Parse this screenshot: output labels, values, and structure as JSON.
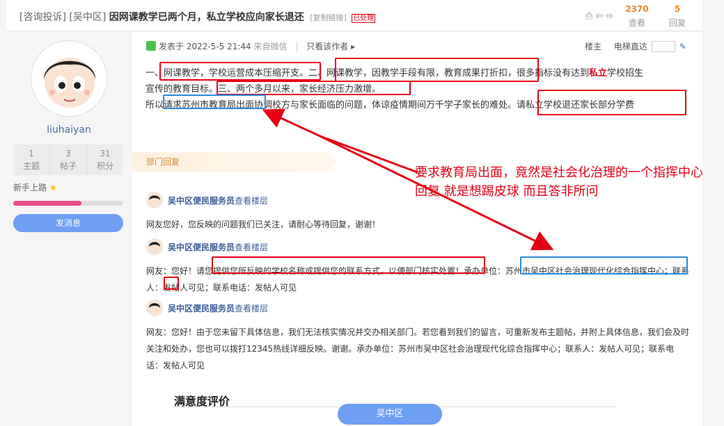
{
  "header": {
    "tags": [
      "[咨询投诉]",
      "[吴中区]"
    ],
    "title": "因网课教学已两个月，私立学校应向家长退还",
    "copy_link": "[复制链接]",
    "status_badge": "已处理",
    "tool_icons": [
      "print-icon",
      "prev-icon",
      "next-icon"
    ],
    "views_count": "2370",
    "views_label": "查看",
    "replies_count": "5",
    "replies_label": "回复"
  },
  "user": {
    "name": "liuhaiyan",
    "stats": [
      {
        "value": "1",
        "label": "主题"
      },
      {
        "value": "3",
        "label": "帖子"
      },
      {
        "value": "31",
        "label": "积分"
      }
    ],
    "level": "新手上路",
    "level_progress": 0.62,
    "message_button": "发消息"
  },
  "post": {
    "published": "发表于 2022-5-5 21:44",
    "source": "来自微信",
    "only_author": "只看该作者",
    "floor_label": "楼主",
    "jump_label": "电梯直达",
    "lines": [
      {
        "pre": "一、网课教学，学校运营成本压缩开支。二、网课教学，因教学手段有限，教育成果打折扣，很多指标没有达到",
        "red": "私立",
        "post": "学校招生"
      },
      {
        "pre": "宣传的教育目标。三、两个多月以来，家长经济压力激增。",
        "red": "",
        "post": ""
      },
      {
        "pre": "所以请求苏州市教育局出面协调校方与家长面临的问题，体谅疫情期间万千学子家长的难处。请私立学校退还家长部分学费",
        "red": "",
        "post": ""
      }
    ]
  },
  "department": {
    "title": "部门回复",
    "replies": [
      {
        "author": "吴中区便民服务员",
        "link": "查看楼层",
        "body": "网友您好，您反映的问题我们已关注，请耐心等待回复，谢谢！"
      },
      {
        "author": "吴中区便民服务员",
        "link": "查看楼层",
        "body": "网友：您好！请您提供您所反映的学校名称或提供您的联系方式，以便部门核实处置！承办单位：苏州市吴中区社会治理现代化综合指挥中心；联系人：发帖人可见；联系电话：发帖人可见"
      },
      {
        "author": "吴中区便民服务员",
        "link": "查看楼层",
        "body": "网友：您好！由于您未留下具体信息，我们无法核实情况并交办相关部门。若您看到我们的留言，可重新发布主题帖，并附上具体信息，我们会及时关注和处办，您也可以拨打12345热线详细反映。谢谢。承办单位：苏州市吴中区社会治理现代化综合指挥中心；联系人：发帖人可见；联系电话：发帖人可见"
      }
    ]
  },
  "satisfaction_title": "满意度评价",
  "bottom_button": "吴中区",
  "annotation": "要求教育局出面，竟然是社会化治理的一个指挥中心回复 就是想踢皮球 而且答非所问",
  "colors": {
    "annotation_red": "#e60012",
    "highlight_blue": "#2d8ae0",
    "accent_orange": "#f08a24",
    "button_blue": "#6c9ef2"
  }
}
